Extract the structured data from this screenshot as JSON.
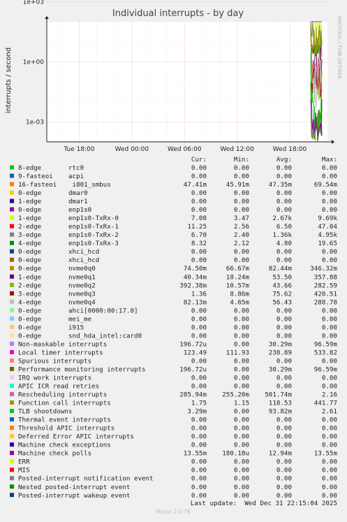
{
  "title": "Individual interrupts - by day",
  "side_text": "RRDTOOL / TOBI OETIKER",
  "footer": "Munin 2.0.76",
  "last_update": "Last update:  Wed Dec 31 22:15:04 2025",
  "table_headers": [
    "Cur:",
    "Min:",
    "Avg:",
    "Max:"
  ],
  "colors": {
    "background": "#f0f0f0",
    "plot": "#ffffff",
    "grid": "#ff9d9d"
  },
  "chart_data": {
    "type": "line",
    "title": "Individual interrupts - by day",
    "ylabel": "interrupts / second",
    "yscale": "log",
    "ylim": [
      0.0001,
      100
    ],
    "yticks": [
      0.001,
      1,
      1000
    ],
    "ytick_labels": [
      "1e-03",
      "1e+00",
      "1e+03"
    ],
    "xtick_labels": [
      "Tue 18:00",
      "Wed 00:00",
      "Wed 06:00",
      "Wed 12:00",
      "Wed 18:00"
    ],
    "x_hours": [
      18,
      24,
      30,
      36,
      42
    ],
    "x_range_hours": [
      14.3,
      46.3
    ],
    "data_start_hour": 44.4,
    "grid": true,
    "series": [
      {
        "label": "8-edge",
        "name": "rtc0",
        "color": "#00cc00",
        "cur": "0.00",
        "min": "0.00",
        "avg": "0.00",
        "max": "0.00",
        "level": 0
      },
      {
        "label": "9-fasteoi",
        "name": "acpi",
        "color": "#0066b3",
        "cur": "0.00",
        "min": "0.00",
        "avg": "0.00",
        "max": "0.00",
        "level": 0
      },
      {
        "label": "16-fasteoi",
        "name": " i801_smbus",
        "color": "#ff8000",
        "cur": "47.41m",
        "min": "45.91m",
        "avg": "47.35m",
        "max": "69.54m",
        "level": 0.0474
      },
      {
        "label": "0-edge",
        "name": "dmar0",
        "color": "#ffcc00",
        "cur": "0.00",
        "min": "0.00",
        "avg": "0.00",
        "max": "0.00",
        "level": 0
      },
      {
        "label": "1-edge",
        "name": "dmar1",
        "color": "#330099",
        "cur": "0.00",
        "min": "0.00",
        "avg": "0.00",
        "max": "0.00",
        "level": 0
      },
      {
        "label": "0-edge",
        "name": "enp1s0",
        "color": "#990099",
        "cur": "0.00",
        "min": "0.00",
        "avg": "0.00",
        "max": "0.00",
        "level": 0
      },
      {
        "label": "1-edge",
        "name": "enp1s0-TxRx-0",
        "color": "#ccff00",
        "cur": "7.08",
        "min": "3.47",
        "avg": "2.67k",
        "max": "9.69k",
        "level": 7.08
      },
      {
        "label": "2-edge",
        "name": "enp1s0-TxRx-1",
        "color": "#ff0000",
        "cur": "11.25",
        "min": "2.56",
        "avg": "6.50",
        "max": "47.04",
        "level": 11.25
      },
      {
        "label": "3-edge",
        "name": "enp1s0-TxRx-2",
        "color": "#808080",
        "cur": "6.70",
        "min": "2.40",
        "avg": "1.36k",
        "max": "4.95k",
        "level": 6.7
      },
      {
        "label": "4-edge",
        "name": "enp1s0-TxRx-3",
        "color": "#008f00",
        "cur": "8.32",
        "min": "2.12",
        "avg": "4.80",
        "max": "19.65",
        "level": 8.32
      },
      {
        "label": "0-edge",
        "name": "xhci_hcd",
        "color": "#00487d",
        "cur": "0.00",
        "min": "0.00",
        "avg": "0.00",
        "max": "0.00",
        "level": 0
      },
      {
        "label": "0-edge",
        "name": "xhci_hcd",
        "color": "#b35a00",
        "cur": "0.00",
        "min": "0.00",
        "avg": "0.00",
        "max": "0.00",
        "level": 0
      },
      {
        "label": "0-edge",
        "name": "nvme0q0",
        "color": "#b38f00",
        "cur": "74.50m",
        "min": "66.67m",
        "avg": "82.44m",
        "max": "346.32m",
        "level": 0.0745
      },
      {
        "label": "1-edge",
        "name": "nvme0q1",
        "color": "#6b006b",
        "cur": "40.34m",
        "min": "18.24m",
        "avg": "53.50",
        "max": "357.88",
        "level": 0.0403
      },
      {
        "label": "2-edge",
        "name": "nvme0q2",
        "color": "#8fb300",
        "cur": "392.38m",
        "min": "10.57m",
        "avg": "43.66",
        "max": "282.59",
        "level": 0.392
      },
      {
        "label": "3-edge",
        "name": "nvme0q3",
        "color": "#b30000",
        "cur": "1.36",
        "min": "8.86m",
        "avg": "75.62",
        "max": "420.51",
        "level": 1.36
      },
      {
        "label": "4-edge",
        "name": "nvme0q4",
        "color": "#bebebe",
        "cur": "82.13m",
        "min": "4.65m",
        "avg": "56.43",
        "max": "288.78",
        "level": 0.0821
      },
      {
        "label": "0-edge",
        "name": "ahci[0000:00:17.0]",
        "color": "#80ff80",
        "cur": "0.00",
        "min": "0.00",
        "avg": "0.00",
        "max": "0.00",
        "level": 0
      },
      {
        "label": "0-edge",
        "name": "mei_me",
        "color": "#80c9ff",
        "cur": "0.00",
        "min": "0.00",
        "avg": "0.00",
        "max": "0.00",
        "level": 0
      },
      {
        "label": "0-edge",
        "name": "i915",
        "color": "#ffc080",
        "cur": "0.00",
        "min": "0.00",
        "avg": "0.00",
        "max": "0.00",
        "level": 0
      },
      {
        "label": "0-edge",
        "name": "snd_hda_intel:card0",
        "color": "#ffe680",
        "cur": "0.00",
        "min": "0.00",
        "avg": "0.00",
        "max": "0.00",
        "level": 0
      },
      {
        "label": "Non-maskable interrupts",
        "name": "",
        "color": "#aa80ff",
        "cur": "196.72u",
        "min": "0.00",
        "avg": "30.29m",
        "max": "96.59m",
        "level": 0.000197
      },
      {
        "label": "Local timer interrupts",
        "name": "",
        "color": "#ee00cc",
        "cur": "123.49",
        "min": "111.93",
        "avg": "238.89",
        "max": "533.82",
        "level": 123.49
      },
      {
        "label": "Spurious interrupts",
        "name": "",
        "color": "#ff8080",
        "cur": "0.00",
        "min": "0.00",
        "avg": "0.00",
        "max": "0.00",
        "level": 0
      },
      {
        "label": "Performance monitoring interrupts",
        "name": "",
        "color": "#666600",
        "cur": "196.72u",
        "min": "0.00",
        "avg": "30.29m",
        "max": "96.59m",
        "level": 0.000197
      },
      {
        "label": "IRQ work interrupts",
        "name": "",
        "color": "#ffbfff",
        "cur": "0.00",
        "min": "0.00",
        "avg": "0.00",
        "max": "0.00",
        "level": 0
      },
      {
        "label": "APIC ICR read retries",
        "name": "",
        "color": "#00ffcc",
        "cur": "0.00",
        "min": "0.00",
        "avg": "0.00",
        "max": "0.00",
        "level": 0
      },
      {
        "label": "Rescheduling interrupts",
        "name": "",
        "color": "#cc6699",
        "cur": "285.94m",
        "min": "255.20m",
        "avg": "501.74m",
        "max": "2.16",
        "level": 0.286
      },
      {
        "label": "Function call interrupts",
        "name": "",
        "color": "#999900",
        "cur": "1.75",
        "min": "1.15",
        "avg": "118.53",
        "max": "441.77",
        "level": 1.75
      },
      {
        "label": "TLB shootdowns",
        "name": "",
        "color": "#00cc00",
        "cur": "3.29m",
        "min": "0.00",
        "avg": "93.82m",
        "max": "2.61",
        "level": 0.00329
      },
      {
        "label": "Thermal event interrupts",
        "name": "",
        "color": "#0066b3",
        "cur": "0.00",
        "min": "0.00",
        "avg": "0.00",
        "max": "0.00",
        "level": 0
      },
      {
        "label": "Threshold APIC interrupts",
        "name": "",
        "color": "#ff8000",
        "cur": "0.00",
        "min": "0.00",
        "avg": "0.00",
        "max": "0.00",
        "level": 0
      },
      {
        "label": "Deferred Error APIC interrupts",
        "name": "",
        "color": "#ffcc00",
        "cur": "0.00",
        "min": "0.00",
        "avg": "0.00",
        "max": "0.00",
        "level": 0
      },
      {
        "label": "Machine check exceptions",
        "name": "",
        "color": "#330099",
        "cur": "0.00",
        "min": "0.00",
        "avg": "0.00",
        "max": "0.00",
        "level": 0
      },
      {
        "label": "Machine check polls",
        "name": "",
        "color": "#990099",
        "cur": "13.55m",
        "min": "180.18u",
        "avg": "12.94m",
        "max": "13.55m",
        "level": 0.01355
      },
      {
        "label": "ERR",
        "name": "",
        "color": "#ccff00",
        "cur": "0.00",
        "min": "0.00",
        "avg": "0.00",
        "max": "0.00",
        "level": 0
      },
      {
        "label": "MIS",
        "name": "",
        "color": "#ff0000",
        "cur": "0.00",
        "min": "0.00",
        "avg": "0.00",
        "max": "0.00",
        "level": 0
      },
      {
        "label": "Posted-interrupt notification event",
        "name": "",
        "color": "#808080",
        "cur": "0.00",
        "min": "0.00",
        "avg": "0.00",
        "max": "0.00",
        "level": 0
      },
      {
        "label": "Nested posted-interrupt event",
        "name": "",
        "color": "#008f00",
        "cur": "0.00",
        "min": "0.00",
        "avg": "0.00",
        "max": "0.00",
        "level": 0
      },
      {
        "label": "Posted-interrupt wakeup event",
        "name": "",
        "color": "#00487d",
        "cur": "0.00",
        "min": "0.00",
        "avg": "0.00",
        "max": "0.00",
        "level": 0
      }
    ]
  }
}
